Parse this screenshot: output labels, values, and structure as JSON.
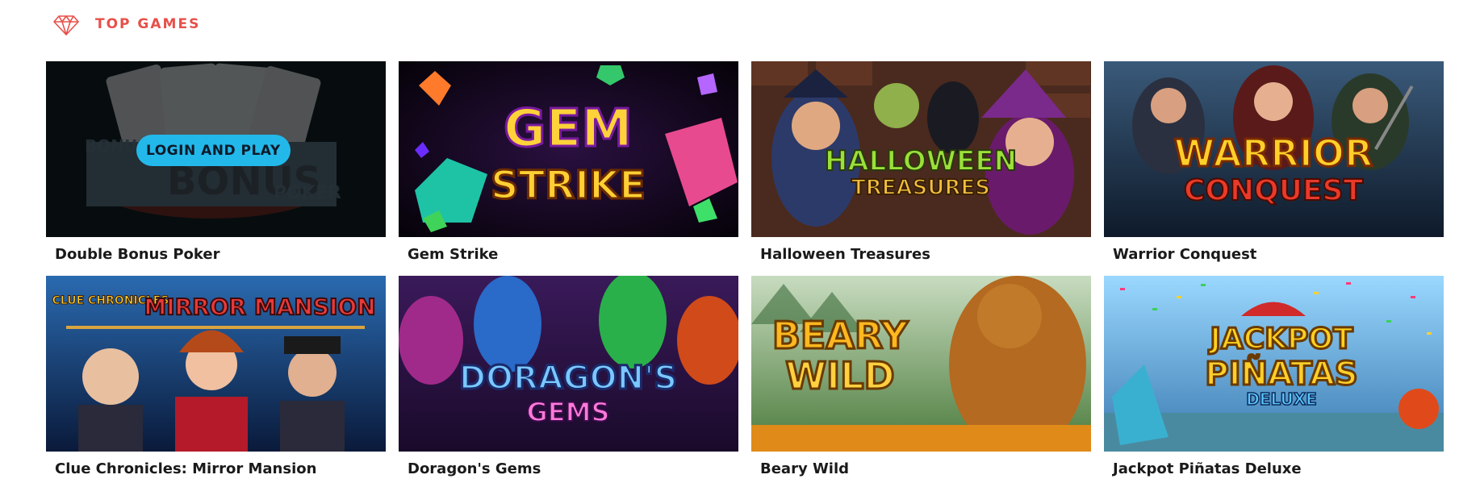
{
  "section": {
    "title": "TOP GAMES",
    "icon": "gem-icon",
    "accent": "#e8504a"
  },
  "login_button": {
    "label": "LOGIN AND PLAY",
    "color": "#23b8ea"
  },
  "games": [
    {
      "title": "Double Bonus Poker",
      "logo": [
        "BONUS",
        "POKER"
      ]
    },
    {
      "title": "Gem Strike",
      "logo": [
        "GEM",
        "STRIKE"
      ]
    },
    {
      "title": "Halloween Treasures",
      "logo": [
        "HALLOWEEN",
        "TREASURES"
      ]
    },
    {
      "title": "Warrior Conquest",
      "logo": [
        "WARRIOR",
        "CONQUEST"
      ]
    },
    {
      "title": "Clue Chronicles: Mirror Mansion",
      "logo": [
        "CLUE CHRONICLES",
        "MIRROR MANSION"
      ]
    },
    {
      "title": "Doragon's Gems",
      "logo": [
        "DORAGON'S",
        "GEMS"
      ]
    },
    {
      "title": "Beary Wild",
      "logo": [
        "BEARY",
        "WILD"
      ]
    },
    {
      "title": "Jackpot Piñatas Deluxe",
      "logo": [
        "JACKPOT",
        "PIÑATAS",
        "DELUXE"
      ]
    }
  ]
}
